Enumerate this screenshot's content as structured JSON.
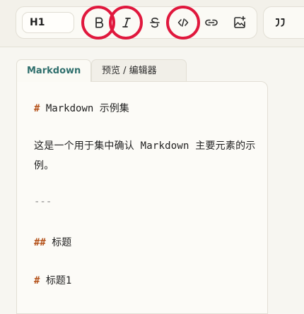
{
  "toolbar": {
    "heading_select": "H1",
    "buttons": [
      {
        "name": "bold",
        "icon": "bold-icon",
        "highlighted": true
      },
      {
        "name": "italic",
        "icon": "italic-icon",
        "highlighted": true
      },
      {
        "name": "strikethrough",
        "icon": "strikethrough-icon",
        "highlighted": false
      },
      {
        "name": "code",
        "icon": "code-icon",
        "highlighted": true
      },
      {
        "name": "link",
        "icon": "link-icon",
        "highlighted": false
      },
      {
        "name": "image",
        "icon": "image-add-icon",
        "highlighted": false
      },
      {
        "name": "quote",
        "icon": "quote-icon",
        "highlighted": false
      }
    ],
    "highlight_color": "#e0183d"
  },
  "tabs": [
    {
      "label": "Markdown",
      "active": true
    },
    {
      "label": "预览 / 编辑器",
      "active": false
    }
  ],
  "editor": {
    "line1_hash": "#",
    "line1_text": " Markdown 示例集",
    "paragraph": "这是一个用于集中确认 Markdown 主要元素的示例。",
    "hr": "---",
    "h2_hash": "##",
    "h2_text": " 标题",
    "h1_hash": "#",
    "h1_text": " 标题1"
  },
  "colors": {
    "accent_tab": "#2f6f6d",
    "markdown_hash": "#b5531c",
    "background": "#f7f6f1"
  }
}
